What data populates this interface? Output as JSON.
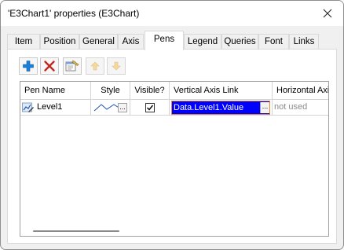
{
  "window": {
    "title": "'E3Chart1' properties (E3Chart)"
  },
  "tabs": [
    {
      "label": "Item",
      "active": false
    },
    {
      "label": "Position",
      "active": false
    },
    {
      "label": "General",
      "active": false
    },
    {
      "label": "Axis",
      "active": false
    },
    {
      "label": "Pens",
      "active": true
    },
    {
      "label": "Legend",
      "active": false
    },
    {
      "label": "Queries",
      "active": false
    },
    {
      "label": "Font",
      "active": false
    },
    {
      "label": "Links",
      "active": false
    }
  ],
  "toolbar": {
    "buttons": [
      {
        "icon": "add-pen-icon",
        "enabled": true
      },
      {
        "icon": "delete-pen-icon",
        "enabled": true
      },
      {
        "icon": "pen-properties-icon",
        "enabled": true
      },
      {
        "icon": "move-up-icon",
        "enabled": false
      },
      {
        "icon": "move-down-icon",
        "enabled": false
      }
    ]
  },
  "grid": {
    "columns": [
      "Pen Name",
      "Style",
      "Visible?",
      "Vertical Axis Link",
      "Horizontal Axi"
    ],
    "rows": [
      {
        "icon": "pen-icon",
        "pen_name": "Level1",
        "style_button": "...",
        "visible": true,
        "vertical_axis_link": "Data.Level1.Value",
        "vertical_axis_button": "...",
        "horizontal_axis_link": "not used"
      }
    ]
  },
  "colors": {
    "selection_bg": "#0000ff",
    "selection_border": "#e08a2e",
    "add_icon": "#1e7fd6",
    "delete_icon": "#c0281e"
  }
}
